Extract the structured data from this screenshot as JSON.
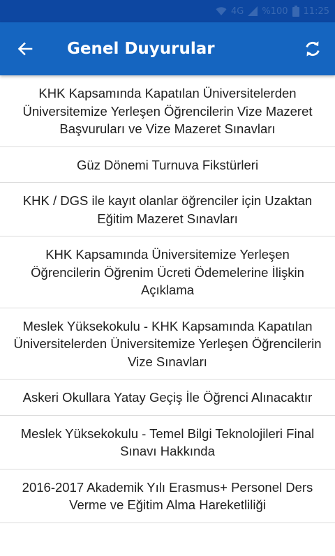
{
  "status_bar": {
    "network": "4G",
    "signal": "%100",
    "time": "11:25"
  },
  "app_bar": {
    "title": "Genel Duyurular",
    "back_icon": "arrow-left-icon",
    "refresh_icon": "refresh-icon",
    "background": "#1565c0",
    "status_background": "#0d47a1"
  },
  "announcements": [
    "KHK Kapsamında Kapatılan Üniversitelerden Üniversitemize Yerleşen Öğrencilerin Vize Mazeret Başvuruları ve Vize Mazeret Sınavları",
    "Güz Dönemi Turnuva Fikstürleri",
    "KHK / DGS ile kayıt olanlar öğrenciler için Uzaktan Eğitim Mazeret Sınavları",
    "KHK Kapsamında Üniversitemize Yerleşen Öğrencilerin Öğrenim Ücreti Ödemelerine İlişkin Açıklama",
    "Meslek Yüksekokulu - KHK Kapsamında Kapatılan Üniversitelerden Üniversitemize Yerleşen Öğrencilerin Vize Sınavları",
    "Askeri Okullara Yatay Geçiş İle Öğrenci Alınacaktır",
    "Meslek Yüksekokulu - Temel Bilgi Teknolojileri Final Sınavı Hakkında",
    "2016-2017 Akademik Yılı Erasmus+ Personel Ders Verme ve Eğitim Alma Hareketliliği"
  ]
}
